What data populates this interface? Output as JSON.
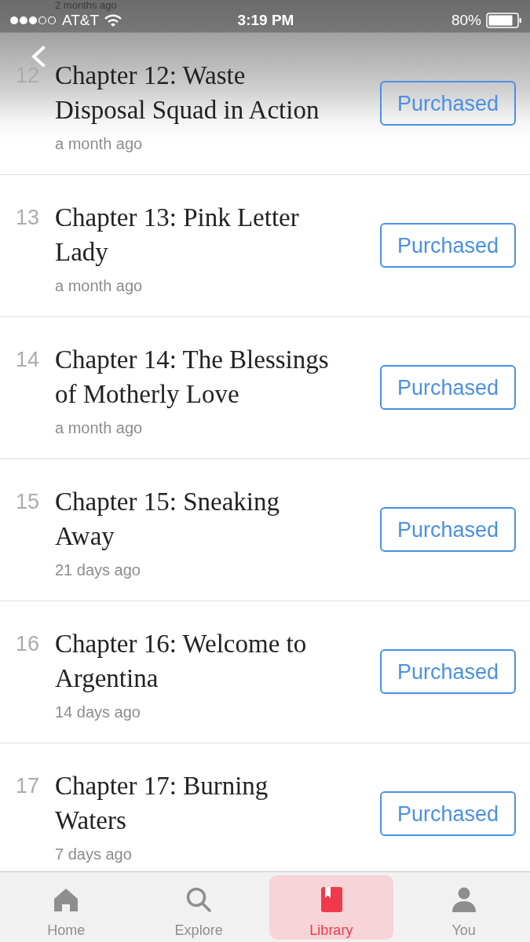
{
  "status_bar": {
    "carrier": "AT&T",
    "time": "3:19 PM",
    "battery": "80%"
  },
  "partial_row": {
    "timestamp": "2 months ago"
  },
  "chapters": [
    {
      "number": "12",
      "title": "Chapter 12: Waste Disposal Squad in Action",
      "timestamp": "a month ago",
      "button": "Purchased"
    },
    {
      "number": "13",
      "title": "Chapter 13: Pink Letter Lady",
      "timestamp": "a month ago",
      "button": "Purchased"
    },
    {
      "number": "14",
      "title": "Chapter 14: The Blessings of Motherly Love",
      "timestamp": "a month ago",
      "button": "Purchased"
    },
    {
      "number": "15",
      "title": "Chapter 15: Sneaking Away",
      "timestamp": "21 days ago",
      "button": "Purchased"
    },
    {
      "number": "16",
      "title": "Chapter 16: Welcome to Argentina",
      "timestamp": "14 days ago",
      "button": "Purchased"
    },
    {
      "number": "17",
      "title": "Chapter 17: Burning Waters",
      "timestamp": "7 days ago",
      "button": "Purchased"
    }
  ],
  "tabs": [
    {
      "label": "Home",
      "selected": false
    },
    {
      "label": "Explore",
      "selected": false
    },
    {
      "label": "Library",
      "selected": true
    },
    {
      "label": "You",
      "selected": false
    }
  ]
}
